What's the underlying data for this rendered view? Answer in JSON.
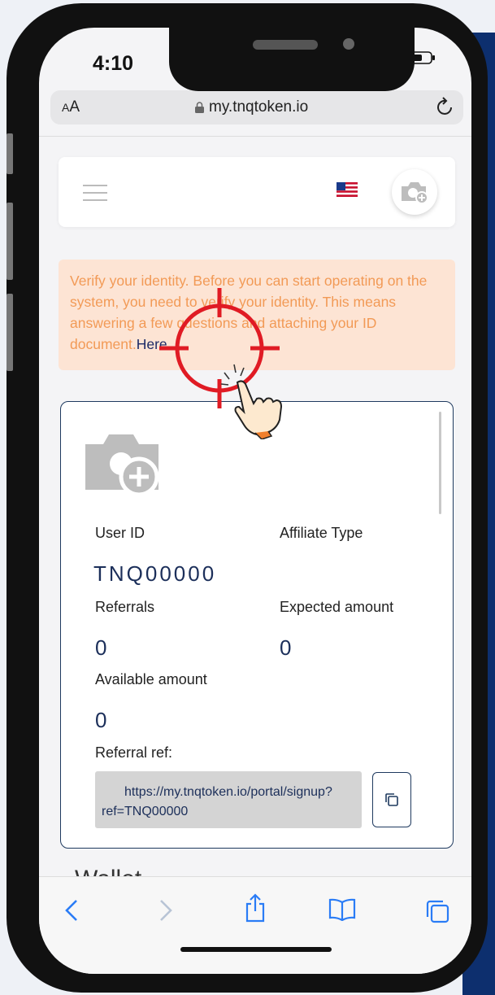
{
  "status_bar": {
    "time": "4:10"
  },
  "browser": {
    "aa_label": "AA",
    "url": "my.tnqtoken.io"
  },
  "colors": {
    "accent": "#1c2f5a",
    "alert_bg": "#fde4d4",
    "alert_text": "#f29a56",
    "brand_stripe": "#0d2f6e"
  },
  "header": {
    "flag": "us-flag-icon",
    "avatar": "camera-add-icon"
  },
  "alert": {
    "message": "Verify your identity. Before you can start operating on the system, you need to verify your identity. This means answering a few questions and attaching your ID document.",
    "link_label": "Here"
  },
  "profile": {
    "user_id_label": "User ID",
    "user_id_value": "TNQ00000",
    "affiliate_type_label": "Affiliate Type",
    "referrals_label": "Referrals",
    "referrals_value": "0",
    "expected_amount_label": "Expected amount",
    "expected_amount_value": "0",
    "available_amount_label": "Available amount",
    "available_amount_value": "0",
    "referral_ref_label": "Referral ref:",
    "referral_link_line1": "https://my.tnqtoken.io/portal/signup?",
    "referral_link_line2": "ref=TNQ00000"
  },
  "wallet_heading": "Wallet",
  "toolbar": [
    "back-icon",
    "forward-icon",
    "share-icon",
    "bookmarks-icon",
    "tabs-icon"
  ]
}
